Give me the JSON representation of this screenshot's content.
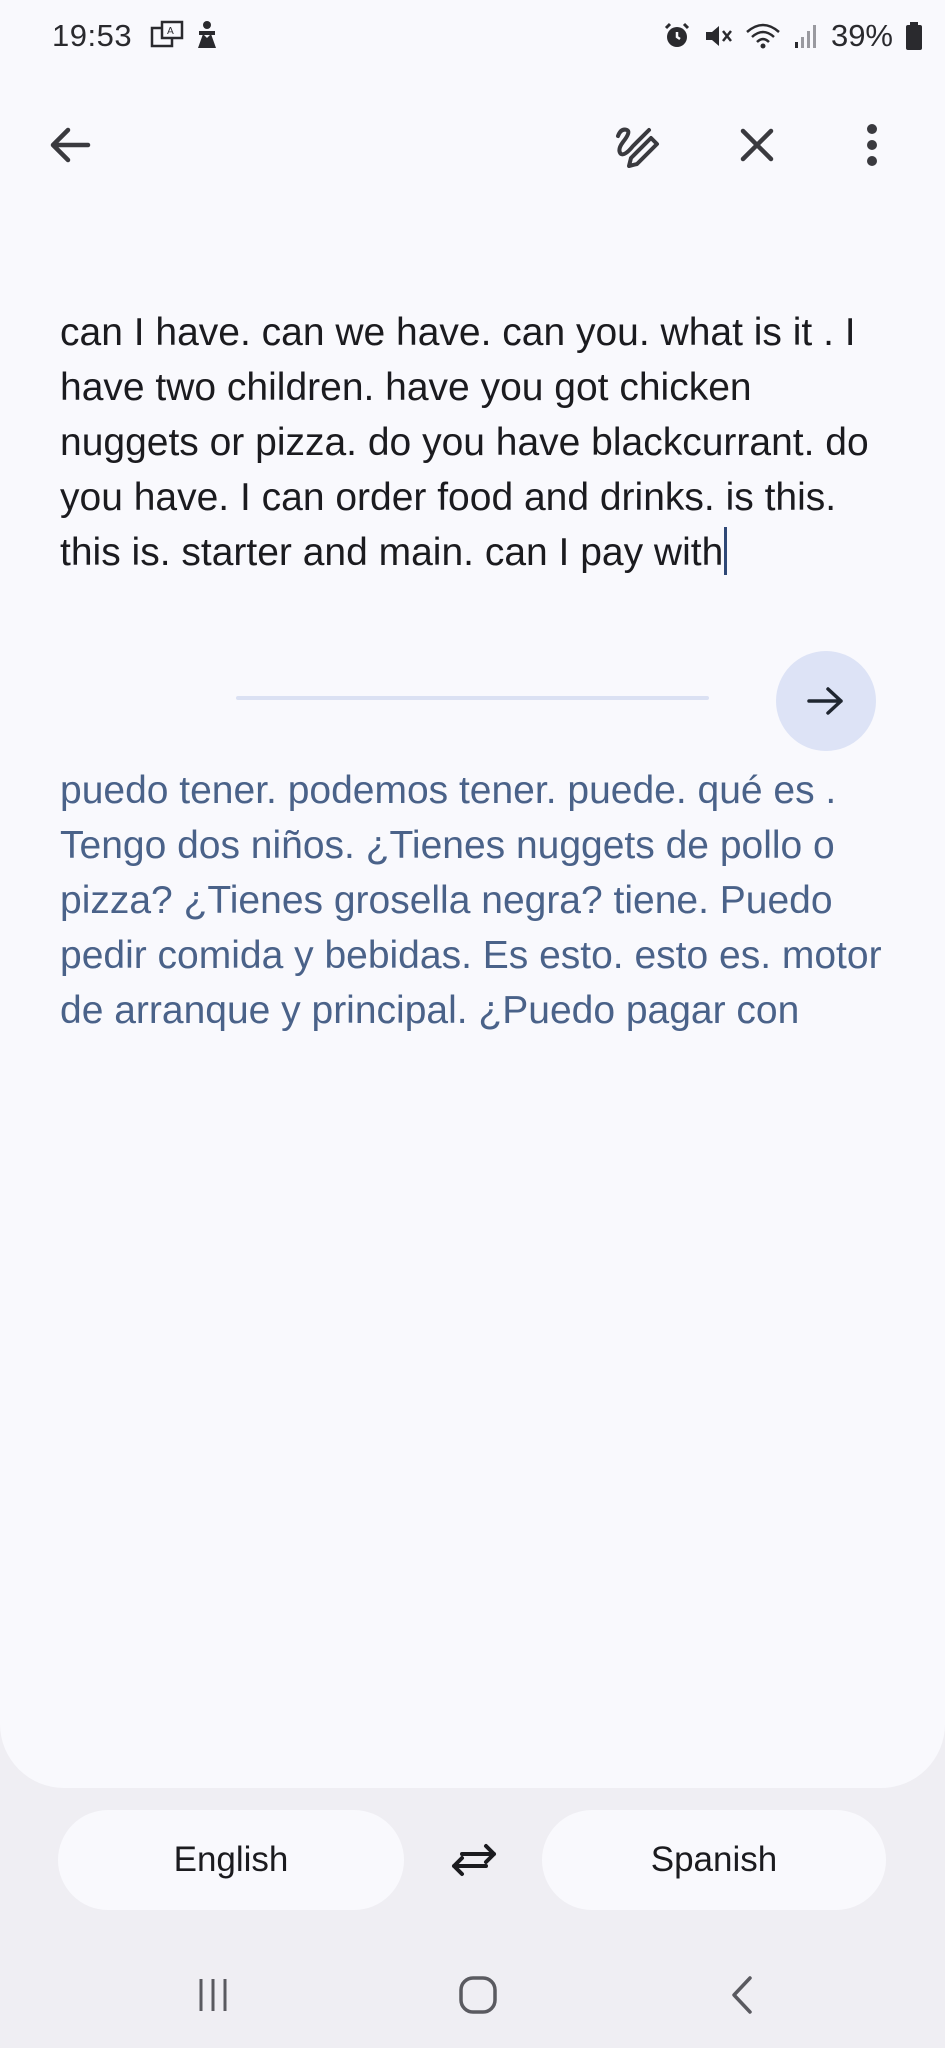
{
  "status_bar": {
    "time": "19:53",
    "battery": "39%",
    "left_icons": [
      "translate-notification-icon",
      "accessibility-icon"
    ],
    "right_icons": [
      "alarm-icon",
      "mute-icon",
      "wifi-icon",
      "signal-icon",
      "battery-icon"
    ]
  },
  "toolbar": {
    "icons": [
      "back-arrow-icon",
      "handwriting-icon",
      "close-icon",
      "more-vert-icon"
    ]
  },
  "source_text": "can I have. can we have.  can you.  what is it . I have two children.  have you got chicken nuggets or pizza. do you have blackcurrant.  do you have.  I can order food and drinks. is this. this is. starter and main. can I pay with",
  "translated_text": "puedo tener.  podemos tener.  puede.  qué es .  Tengo dos niños.  ¿Tienes nuggets de pollo o pizza?  ¿Tienes grosella negra?  tiene.  Puedo pedir comida y bebidas.  Es esto.  esto es.  motor de arranque y principal.  ¿Puedo pagar con",
  "languages": {
    "source": "English",
    "target": "Spanish"
  },
  "colors": {
    "accent": "#dde3f6",
    "translation_text": "#4a6289",
    "background": "#f9f9fd"
  },
  "nav_bar": {
    "icons": [
      "recents-icon",
      "home-icon",
      "back-icon"
    ]
  }
}
